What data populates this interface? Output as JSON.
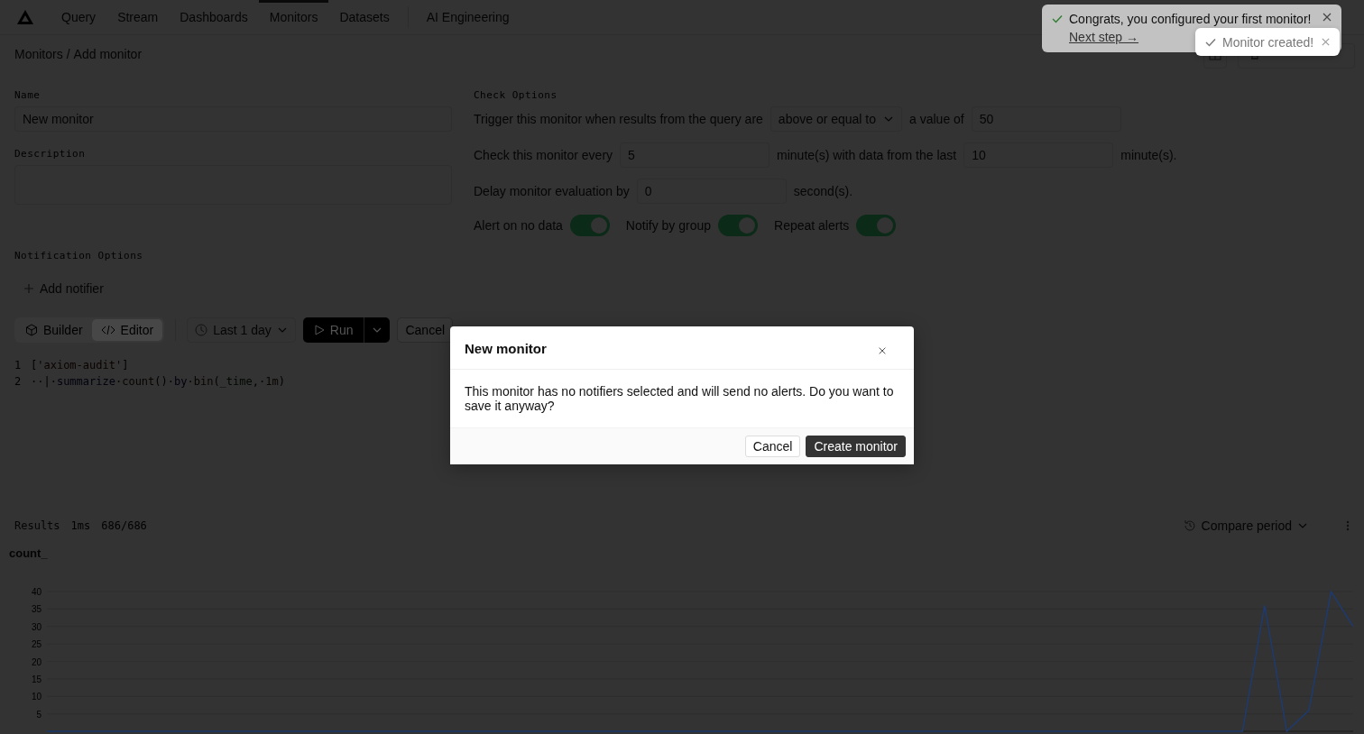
{
  "nav": {
    "items": [
      {
        "label": "Query",
        "selected": false
      },
      {
        "label": "Stream",
        "selected": false
      },
      {
        "label": "Dashboards",
        "selected": false
      },
      {
        "label": "Monitors",
        "selected": true
      },
      {
        "label": "Datasets",
        "selected": false
      },
      {
        "label": "AI Engineering",
        "selected": false
      }
    ]
  },
  "breadcrumb": {
    "items": [
      "Monitors",
      "Add monitor"
    ],
    "separator": "/"
  },
  "form": {
    "name": {
      "label": "Name",
      "value": "New monitor"
    },
    "description": {
      "label": "Description"
    },
    "notification_options": {
      "title": "Notification Options",
      "add_button": "Add notifier"
    }
  },
  "check_options": {
    "title": "Check Options",
    "trigger": {
      "label": "Trigger this monitor when results from the query are",
      "comparison": "above or equal to",
      "value_label": "a value of",
      "value": "50"
    },
    "schedule": {
      "label": "Check this monitor every",
      "interval": "5",
      "range_label": "minute(s) with data from the last",
      "range": "10",
      "unit": "minute(s)."
    },
    "delay": {
      "label": "Delay monitor evaluation by",
      "value": "0",
      "unit": "second(s)."
    },
    "toggles": [
      {
        "label": "Alert on no data",
        "on": true
      },
      {
        "label": "Notify by group",
        "on": true
      },
      {
        "label": "Repeat alerts",
        "on": true
      }
    ]
  },
  "query": {
    "modes": [
      {
        "label": "Builder",
        "selected": false
      },
      {
        "label": "Editor",
        "selected": true
      }
    ],
    "time_range": "Last 1 day",
    "run_button": "Run",
    "cancel_button": {
      "label": "Cancel",
      "disabled": true
    },
    "lines": [
      {
        "number": "1",
        "tokens": [
          {
            "kind": "punct",
            "text": "["
          },
          {
            "kind": "string",
            "text": "'axiom-audit'"
          },
          {
            "kind": "punct",
            "text": "]"
          }
        ]
      },
      {
        "number": "2",
        "tokens": [
          {
            "kind": "ws",
            "text": "··"
          },
          {
            "kind": "punct",
            "text": "|"
          },
          {
            "kind": "ws",
            "text": "·"
          },
          {
            "kind": "keyword",
            "text": "summarize"
          },
          {
            "kind": "ws",
            "text": "·"
          },
          {
            "kind": "func",
            "text": "count"
          },
          {
            "kind": "punct",
            "text": "()"
          },
          {
            "kind": "ws",
            "text": "·"
          },
          {
            "kind": "keyword",
            "text": "by"
          },
          {
            "kind": "ws",
            "text": "·"
          },
          {
            "kind": "func",
            "text": "bin"
          },
          {
            "kind": "punct",
            "text": "("
          },
          {
            "kind": "ident",
            "text": "_time"
          },
          {
            "kind": "punct",
            "text": ","
          },
          {
            "kind": "ws",
            "text": "·"
          },
          {
            "kind": "number",
            "text": "1m"
          },
          {
            "kind": "punct",
            "text": ")"
          }
        ]
      }
    ]
  },
  "results": {
    "label": "Results",
    "duration": "1ms",
    "count": "686/686",
    "compare_button": "Compare period",
    "chart_data": {
      "type": "line",
      "ylim": [
        0,
        40
      ],
      "yticks": [
        5,
        10,
        15,
        20,
        25,
        30,
        35,
        40
      ],
      "categories": [
        null,
        null,
        null,
        null,
        null,
        null,
        null,
        null,
        null,
        null,
        null,
        null,
        null,
        null,
        null,
        null,
        null,
        null,
        null,
        null,
        null,
        null,
        null,
        null,
        null,
        null,
        null,
        null,
        null,
        null,
        null,
        null,
        null,
        null,
        null,
        null,
        null,
        null,
        null,
        null,
        null,
        null,
        null,
        null,
        null,
        null,
        null,
        null,
        null,
        null,
        null,
        null,
        null,
        null,
        null,
        null,
        null,
        null,
        null,
        null
      ],
      "series": [
        {
          "name": "count_",
          "color": "#1e3a6e",
          "values": [
            0,
            0,
            0,
            0,
            0,
            0,
            0,
            0,
            0,
            0,
            0,
            0,
            0,
            0,
            0,
            0,
            0,
            0,
            0,
            0,
            0,
            0,
            0,
            0,
            0,
            0,
            0,
            0,
            0,
            0,
            0,
            0,
            0,
            0,
            0,
            0,
            0,
            0,
            0,
            0,
            0,
            0,
            0,
            0,
            0,
            0,
            0,
            0,
            0,
            0,
            0,
            0,
            0,
            0,
            0,
            36,
            0,
            6,
            40,
            30
          ]
        }
      ]
    }
  },
  "dialog": {
    "title": "New monitor",
    "message": "This monitor has no notifiers selected and will send no alerts. Do you want to save it anyway?",
    "cancel_button": "Cancel",
    "confirm_button": "Create monitor"
  },
  "toasts": [
    {
      "kind": "info",
      "message": "Congrats, you configured your first monitor!",
      "link": "Next step →"
    },
    {
      "kind": "fading",
      "message": "Monitor created!"
    }
  ]
}
